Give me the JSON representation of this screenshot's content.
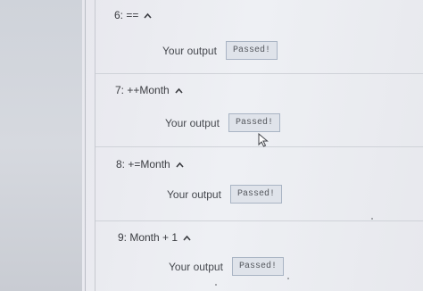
{
  "tests": [
    {
      "header": "6: ==",
      "output_label": "Your output",
      "result": "Passed!"
    },
    {
      "header": "7: ++Month",
      "output_label": "Your output",
      "result": "Passed!"
    },
    {
      "header": "8: +=Month",
      "output_label": "Your output",
      "result": "Passed!"
    },
    {
      "header": "9: Month + 1",
      "output_label": "Your output",
      "result": "Passed!"
    }
  ],
  "icons": {
    "collapse": "chevron-up-icon",
    "pointer": "mouse-cursor-icon"
  },
  "colors": {
    "page_bg": "#eef0f4",
    "badge_bg": "#dfe3ea",
    "badge_border": "#a9b4c4",
    "text": "#3b3d42"
  }
}
